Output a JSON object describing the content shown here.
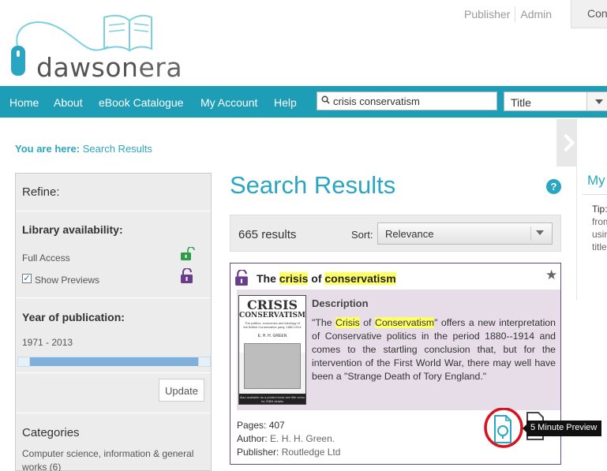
{
  "brand": {
    "logo_text_a": "dawson",
    "logo_text_b": "era"
  },
  "toplinks": {
    "publisher": "Publisher",
    "admin": "Admin",
    "con": "Con"
  },
  "nav": {
    "items": [
      "Home",
      "About",
      "eBook Catalogue",
      "My Account",
      "Help"
    ],
    "search_value": "crisis conservatism",
    "field_select": "Title"
  },
  "breadcrumb": {
    "prefix": "You are here:",
    "current": "Search Results"
  },
  "right_panel": {
    "title": "My",
    "tip_lines": [
      "Tip:",
      "from",
      "usin",
      "title"
    ]
  },
  "refine": {
    "title": "Refine:",
    "availability": {
      "heading": "Library availability:",
      "full_access": "Full Access",
      "show_previews": "Show Previews"
    },
    "year": {
      "heading": "Year of publication:",
      "range": "1971 - 2013"
    },
    "update_label": "Update",
    "categories": {
      "heading": "Categories",
      "item": "Computer science, information & general works (6)"
    }
  },
  "results": {
    "title": "Search Results",
    "count": "665 results",
    "sort_label": "Sort:",
    "sort_value": "Relevance"
  },
  "result": {
    "title_parts": [
      "The ",
      "crisis",
      " of ",
      "conservatism"
    ],
    "description_heading": "Description",
    "description_parts": [
      "\"The ",
      "Crisis",
      " of ",
      "Conservatism",
      "\" offers a new interpretation of Conservative politics in the period 1880--1914 and comes to the startling conclusion that, but for the intervention of the First World War, there may well have been a \"Strange Death of Tory England.\""
    ],
    "pages_label": "Pages:",
    "pages": "407",
    "author_label": "Author:",
    "author": "E. H. H. Green.",
    "publisher_label": "Publisher:",
    "publisher": "Routledge Ltd",
    "cover": {
      "line1": "CRISIS",
      "line2": "CONSERVATISM",
      "small": "The politics, economics and ideology of the British Conservative party, 1880-1914",
      "author": "E. H. H. GREEN",
      "footer": "Also available as a printed book see title verso for ISBN details"
    },
    "preview_tooltip": "5 Minute Preview"
  },
  "colors": {
    "teal": "#1e9db7",
    "purple": "#6a3d8a",
    "green": "#2e9a4a",
    "highlight": "#ffff66",
    "circle": "#d7141d"
  }
}
